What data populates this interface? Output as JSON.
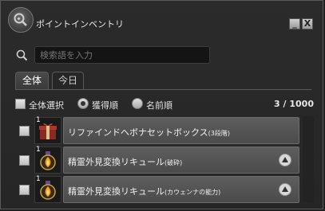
{
  "window": {
    "title": "ポイントインベントリ",
    "minimize_label": "_",
    "close_label": "X"
  },
  "search": {
    "placeholder": "検索語を入力"
  },
  "tabs": [
    {
      "label": "全体",
      "active": true
    },
    {
      "label": "今日",
      "active": false
    }
  ],
  "sort": {
    "select_all_label": "全体選択",
    "options": [
      {
        "label": "獲得順",
        "selected": true
      },
      {
        "label": "名前順",
        "selected": false
      }
    ],
    "count": "3 / 1000"
  },
  "items": [
    {
      "qty": "1",
      "name": "リファインドヘボナセットボックス",
      "suffix": "(3段階)",
      "icon": "gift-box-icon",
      "bound": false
    },
    {
      "qty": "1",
      "name": "精霊外見変換リキュール",
      "suffix": "(破砕)",
      "icon": "potion-icon",
      "bound": true
    },
    {
      "qty": "1",
      "name": "精霊外見変換リキュール",
      "suffix": "(カウェンナの能力)",
      "icon": "potion-icon",
      "bound": true
    }
  ],
  "colors": {
    "window_bg": "#2b2b2b",
    "item_bar": "#565656",
    "accent_text": "#e8e8e8"
  }
}
